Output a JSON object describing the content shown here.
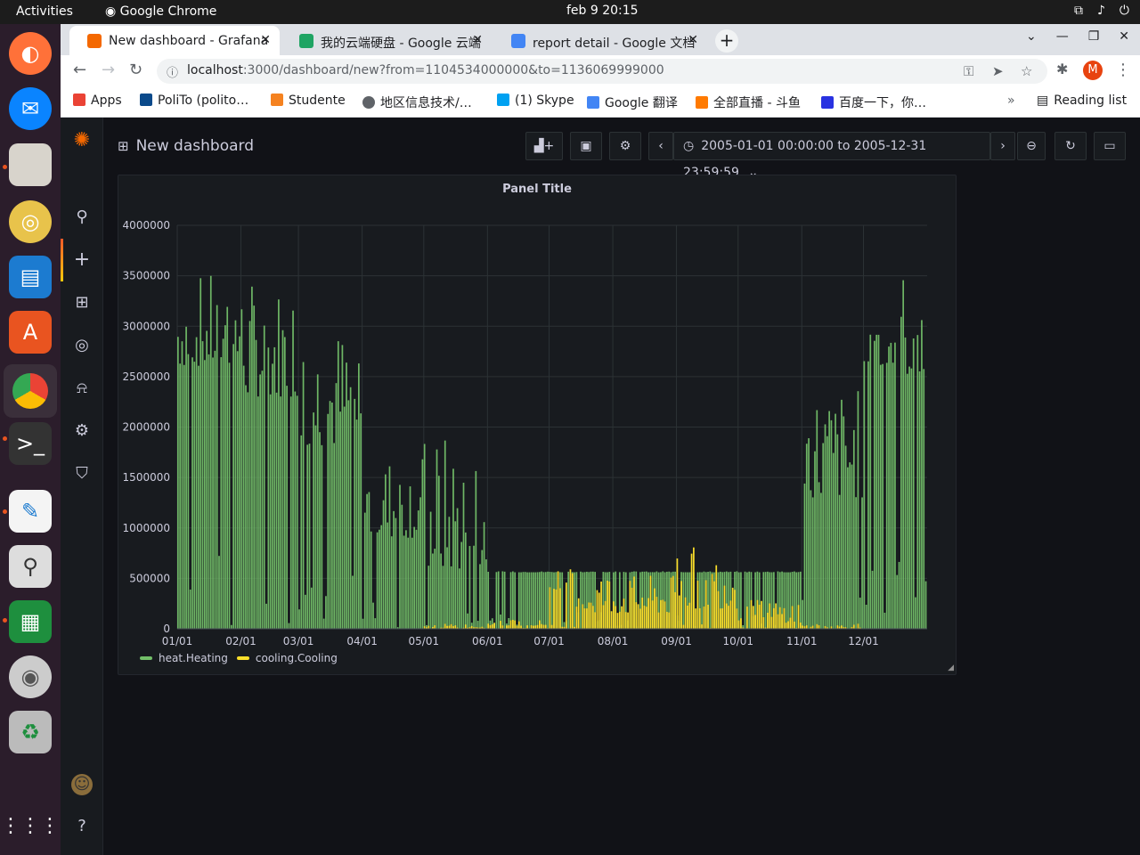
{
  "os": {
    "activities": "Activities",
    "app_name": "Google Chrome",
    "clock": "feb 9  20:15"
  },
  "browser": {
    "tabs": [
      {
        "label": "New dashboard - Grafana",
        "active": true,
        "color": "#f46800"
      },
      {
        "label": "我的云端硬盘 - Google 云端",
        "active": false,
        "color": "#1fa463"
      },
      {
        "label": "report detail - Google 文档",
        "active": false,
        "color": "#4285f4"
      }
    ],
    "url_host": "localhost",
    "url_rest": ":3000/dashboard/new?from=1104534000000&to=1136069999000",
    "profile_initial": "M",
    "bookmarks": [
      {
        "label": "Apps",
        "color": "#ea4335"
      },
      {
        "label": "PoliTo (polito…",
        "color": "#0b4a8b"
      },
      {
        "label": "Studente",
        "color": "#f58220"
      },
      {
        "label": "地区信息技术/…",
        "color": "#5f6368"
      },
      {
        "label": "(1) Skype",
        "color": "#00a1f1"
      },
      {
        "label": "Google 翻译",
        "color": "#4285f4"
      },
      {
        "label": "全部直播 - 斗鱼",
        "color": "#ff7a00"
      },
      {
        "label": "百度一下，你…",
        "color": "#2932e1"
      }
    ],
    "more_bookmarks": "»",
    "reading_list": "Reading list"
  },
  "grafana": {
    "dashboard_title": "New dashboard",
    "time_range": "2005-01-01 00:00:00 to 2005-12-31 23:59:59",
    "panel_title": "Panel Title",
    "legend": [
      {
        "name": "heat.Heating",
        "color": "#73bf69"
      },
      {
        "name": "cooling.Cooling",
        "color": "#fade2a"
      }
    ]
  },
  "chart_data": {
    "type": "bar",
    "title": "Panel Title",
    "xlabel": "",
    "ylabel": "",
    "ylim": [
      0,
      4000000
    ],
    "y_ticks": [
      "0",
      "500000",
      "1000000",
      "1500000",
      "2000000",
      "2500000",
      "3000000",
      "3500000",
      "4000000"
    ],
    "x_ticks": [
      "01/01",
      "02/01",
      "03/01",
      "04/01",
      "05/01",
      "06/01",
      "07/01",
      "08/01",
      "09/01",
      "10/01",
      "11/01",
      "12/01"
    ],
    "x_range": [
      "2005-01-01",
      "2005-12-31"
    ],
    "grid": true,
    "legend_position": "bottom-left",
    "series": [
      {
        "name": "heat.Heating",
        "color": "#73bf69",
        "monthly_peak": [
          3520000,
          3450000,
          3030000,
          1750000,
          1950000,
          570000,
          570000,
          570000,
          570000,
          570000,
          2400000,
          3600000
        ],
        "monthly_typical": [
          2600000,
          2300000,
          1800000,
          900000,
          570000,
          560000,
          560000,
          560000,
          560000,
          560000,
          1300000,
          2500000
        ]
      },
      {
        "name": "cooling.Cooling",
        "color": "#fade2a",
        "monthly_peak": [
          0,
          0,
          0,
          0,
          50000,
          90000,
          600000,
          530000,
          820000,
          300000,
          50000,
          0
        ],
        "monthly_typical": [
          0,
          0,
          0,
          0,
          10000,
          30000,
          150000,
          150000,
          200000,
          60000,
          0,
          0
        ]
      }
    ]
  }
}
